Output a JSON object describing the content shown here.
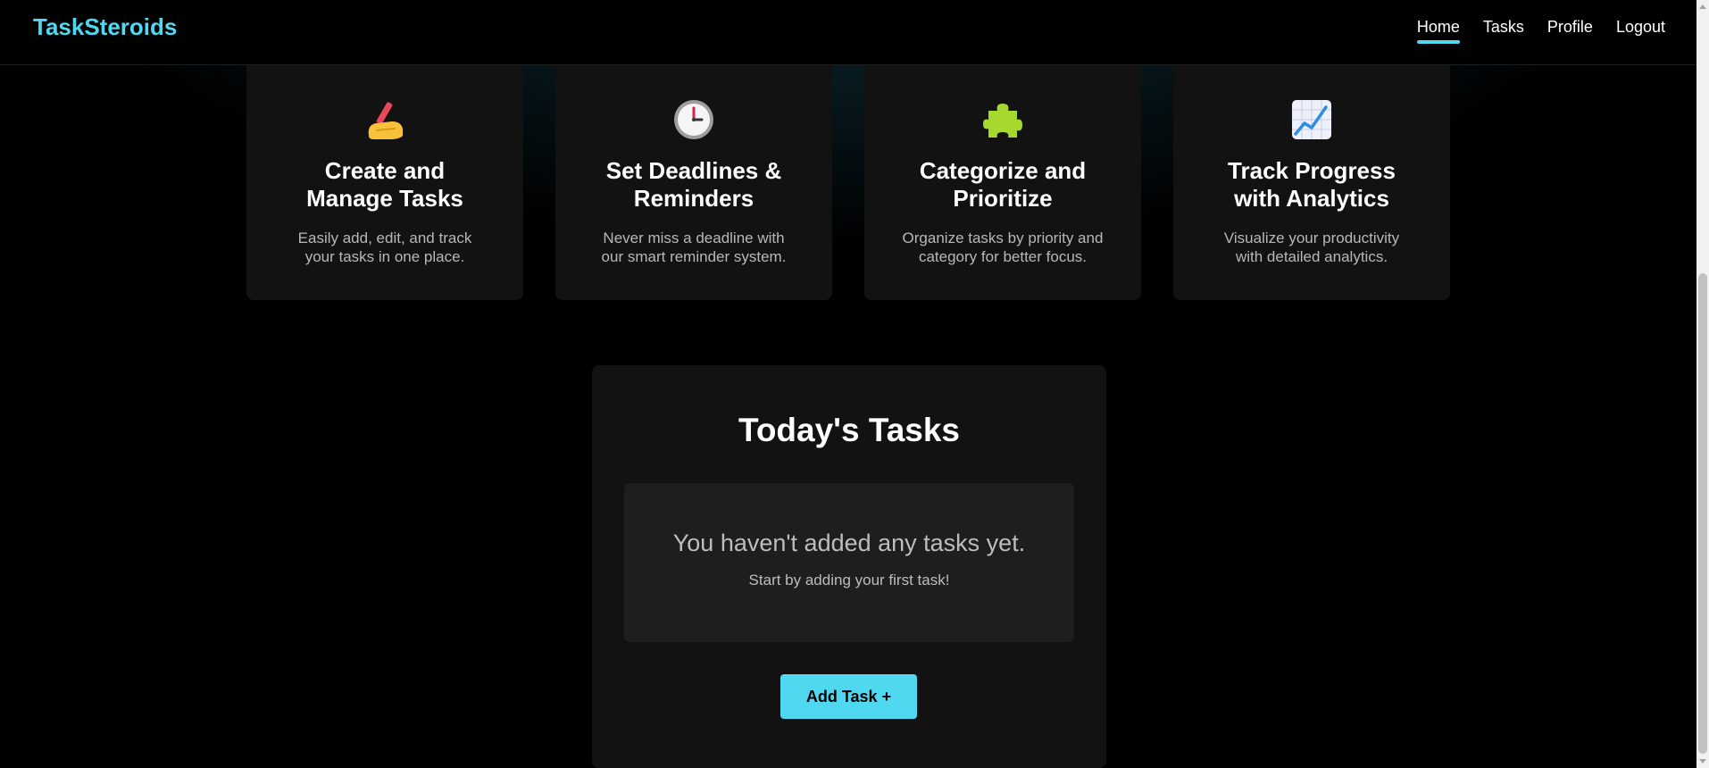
{
  "navbar": {
    "brand": "TaskSteroids",
    "links": [
      {
        "label": "Home",
        "active": true
      },
      {
        "label": "Tasks",
        "active": false
      },
      {
        "label": "Profile",
        "active": false
      },
      {
        "label": "Logout",
        "active": false
      }
    ]
  },
  "features": [
    {
      "icon": "writing-hand-icon",
      "title": "Create and Manage Tasks",
      "description": "Easily add, edit, and track your tasks in one place."
    },
    {
      "icon": "clock-icon",
      "title": "Set Deadlines & Reminders",
      "description": "Never miss a deadline with our smart reminder system."
    },
    {
      "icon": "puzzle-piece-icon",
      "title": "Categorize and Prioritize",
      "description": "Organize tasks by priority and category for better focus."
    },
    {
      "icon": "chart-increasing-icon",
      "title": "Track Progress with Analytics",
      "description": "Visualize your productivity with detailed analytics."
    }
  ],
  "tasks": {
    "title": "Today's Tasks",
    "empty_title": "You haven't added any tasks yet.",
    "empty_subtitle": "Start by adding your first task!",
    "add_button_label": "Add Task +"
  },
  "colors": {
    "accent": "#4fd8f0",
    "background": "#000000",
    "card": "#121212",
    "empty_box": "#1e1e1e"
  }
}
